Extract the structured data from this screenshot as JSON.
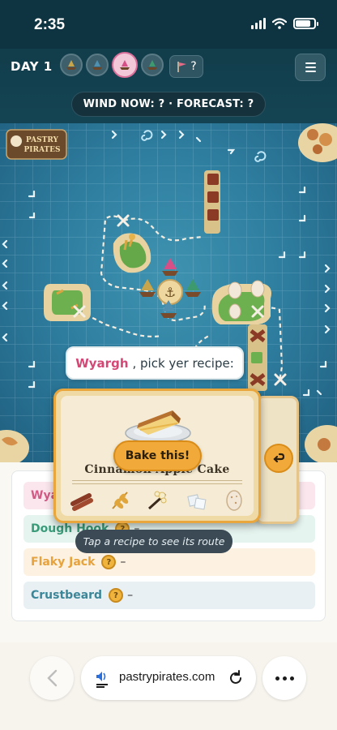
{
  "status_bar": {
    "time": "2:35",
    "battery_level": 0.8
  },
  "top_bar": {
    "day_label": "DAY 1",
    "boats": [
      {
        "name": "boat-1",
        "color": "#c8a44a",
        "active": false
      },
      {
        "name": "boat-2",
        "color": "#4f8fb0",
        "active": false
      },
      {
        "name": "boat-3",
        "color": "#d64f86",
        "active": true
      },
      {
        "name": "boat-4",
        "color": "#3d9a6f",
        "active": false
      }
    ],
    "flag_value": "?",
    "wind_text": "WIND NOW: ? · FORECAST: ?"
  },
  "board": {
    "logo_text_top": "PASTRY",
    "logo_text_bottom": "PIRATES",
    "prompt_player": "Wyargh",
    "prompt_text": ", pick yer recipe:"
  },
  "recipe_card": {
    "name": "Cinnamon Apple Cake",
    "bake_button": "Bake this!",
    "ingredients": [
      "cinnamon",
      "wheat",
      "vanilla",
      "sugar",
      "egg"
    ]
  },
  "tooltip": "Tap a recipe to see its route",
  "players": [
    {
      "name": "Wyargh",
      "coin": "?",
      "score": "–",
      "color": "#d45a86"
    },
    {
      "name": "Dough Hook",
      "coin": "?",
      "score": "–",
      "color": "#3a9b79"
    },
    {
      "name": "Flaky Jack",
      "coin": "?",
      "score": "–",
      "color": "#e6a23c"
    },
    {
      "name": "Crustbeard",
      "coin": "?",
      "score": "–",
      "color": "#3b8699"
    }
  ],
  "browser": {
    "url": "pastrypirates.com"
  },
  "colors": {
    "accent": "#f1a93a",
    "sea": "#2f7fa1",
    "panel": "#faf8f3"
  }
}
